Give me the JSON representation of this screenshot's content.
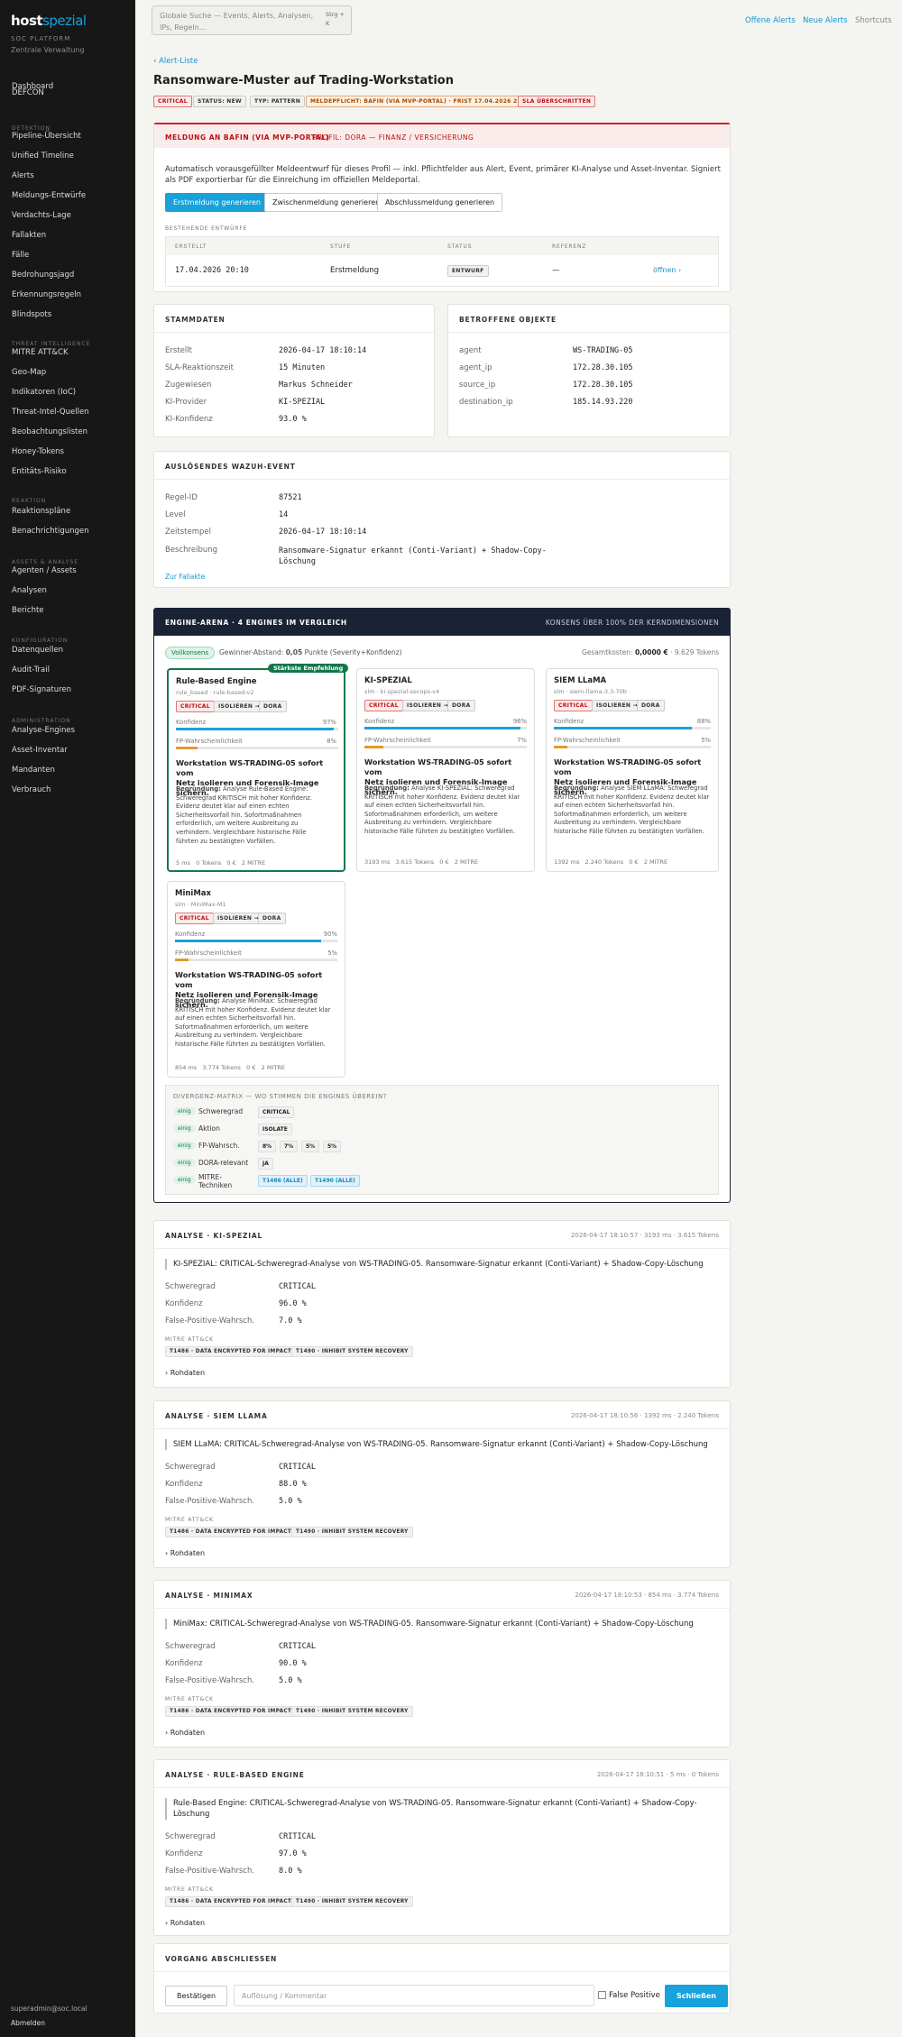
{
  "sidebar": {
    "logo_main": "host",
    "logo_accent": "spezial",
    "platform_label": "SOC PLATFORM",
    "platform_sub": "Zentrale Verwaltung",
    "groups": [
      {
        "title": "",
        "items": [
          "Dashboard",
          "DEFCON"
        ]
      },
      {
        "title": "DETEKTION",
        "items": [
          "Pipeline-Übersicht",
          "Unified Timeline",
          "Alerts",
          "Meldungs-Entwürfe",
          "Verdachts-Lage",
          "Fallakten",
          "Fälle",
          "Bedrohungsjagd",
          "Erkennungsregeln",
          "Blindspots"
        ]
      },
      {
        "title": "THREAT INTELLIGENCE",
        "items": [
          "MITRE ATT&CK",
          "Geo-Map",
          "Indikatoren (IoC)",
          "Threat-Intel-Quellen",
          "Beobachtungslisten",
          "Honey-Tokens",
          "Entitäts-Risiko"
        ]
      },
      {
        "title": "REAKTION",
        "items": [
          "Reaktionspläne",
          "Benachrichtigungen"
        ]
      },
      {
        "title": "ASSETS & ANALYSE",
        "items": [
          "Agenten / Assets",
          "Analysen",
          "Berichte"
        ]
      },
      {
        "title": "KONFIGURATION",
        "items": [
          "Datenquellen",
          "Audit-Trail",
          "PDF-Signaturen"
        ]
      },
      {
        "title": "ADMINISTRATION",
        "items": [
          "Analyse-Engines",
          "Asset-Inventar",
          "Mandanten",
          "Verbrauch"
        ]
      }
    ],
    "user": "superadmin@soc.local",
    "logout": "Abmelden"
  },
  "topbar": {
    "search_placeholder_l1": "Globale Suche — Events, Alerts, Analysen,",
    "search_placeholder_l2": "IPs, Regeln…",
    "shortcut": "Strg + K",
    "links": [
      "Offene Alerts",
      "Neue Alerts",
      "Shortcuts"
    ]
  },
  "page": {
    "back": "‹ Alert-Liste",
    "title": "Ransomware-Muster auf Trading-Workstation",
    "badges": [
      "CRITICAL",
      "STATUS: NEW",
      "TYP: PATTERN",
      "MELDEPFLICHT: BAFIN (VIA MVP-PORTAL) · FRIST 17.04.2026 22:10",
      "SLA ÜBERSCHRITTEN"
    ]
  },
  "bafin": {
    "title": "MELDUNG AN BAFIN (VIA MVP-PORTAL)",
    "profile": "PROFIL: DORA — FINANZ / VERSICHERUNG",
    "desc_l1": "Automatisch vorausgefüllter Meldeentwurf für dieses Profil — inkl. Pflichtfelder aus Alert, Event, primärer KI-Analyse und Asset-Inventar. Signiert",
    "desc_l2": "als PDF exportierbar für die Einreichung im offiziellen Meldeportal.",
    "buttons": [
      "Erstmeldung generieren",
      "Zwischenmeldung generieren",
      "Abschlussmeldung generieren"
    ],
    "drafts_title": "BESTEHENDE ENTWÜRFE",
    "columns": [
      "ERSTELLT",
      "STUFE",
      "STATUS",
      "REFERENZ"
    ],
    "row": {
      "created": "17.04.2026 20:10",
      "stage": "Erstmeldung",
      "status": "ENTWURF",
      "ref": "—",
      "action": "öffnen ›"
    }
  },
  "stamm": {
    "title": "STAMMDATEN",
    "rows": [
      {
        "k": "Erstellt",
        "v": "2026-04-17 18:10:14"
      },
      {
        "k": "SLA-Reaktionszeit",
        "v": "15 Minuten"
      },
      {
        "k": "Zugewiesen",
        "v": "Markus Schneider"
      },
      {
        "k": "KI-Provider",
        "v": "KI-SPEZIAL"
      },
      {
        "k": "KI-Konfidenz",
        "v": "93.0 %"
      }
    ]
  },
  "objects": {
    "title": "BETROFFENE OBJEKTE",
    "rows": [
      {
        "k": "agent",
        "v": "WS-TRADING-05"
      },
      {
        "k": "agent_ip",
        "v": "172.28.30.105"
      },
      {
        "k": "source_ip",
        "v": "172.28.30.105"
      },
      {
        "k": "destination_ip",
        "v": "185.14.93.220"
      }
    ]
  },
  "wazuh": {
    "title": "AUSLÖSENDES WAZUH-EVENT",
    "rows": [
      {
        "k": "Regel-ID",
        "v": "87521"
      },
      {
        "k": "Level",
        "v": "14"
      },
      {
        "k": "Zeitstempel",
        "v": "2026-04-17 18:10:14"
      }
    ],
    "desc_label": "Beschreibung",
    "desc_l1": "Ransomware-Signatur erkannt (Conti-Variant) + Shadow-Copy-",
    "desc_l2": "Löschung",
    "link": "Zur Fallakte"
  },
  "arena": {
    "title": "ENGINE-ARENA · 4 ENGINES IM VERGLEICH",
    "consensus": "KONSENS ÜBER 100% DER KERNDIMENSIONEN",
    "badge": "Vollkonsens",
    "gap_pre": "Gewinner-Abstand:",
    "gap_val": "0,05",
    "gap_post": "Punkte (Severity+Konfidenz)",
    "cost_pre": "Gesamtkosten:",
    "cost_val": "0,0000 €",
    "cost_post": "· 9.629 Tokens",
    "best_label": "Stärkste Empfehlung",
    "engines": [
      {
        "name": "Rule-Based Engine",
        "sub": "rule_based · rule-based-v2",
        "tags": [
          "CRITICAL",
          "ISOLIEREN →",
          "DORA"
        ],
        "conf_lbl": "Konfidenz",
        "conf": "97%",
        "conf_v": 0.97,
        "fp_lbl": "FP-Wahrscheinlichkeit",
        "fp": "8%",
        "fp_v": 0.08,
        "rec_l1": "Workstation WS-TRADING-05 sofort vom",
        "rec_l2": "Netz isolieren und Forensik-Image sichern.",
        "reason_lbl": "Begründung:",
        "reason": [
          "Analyse Rule-Based Engine:",
          "Schweregrad KRITISCH mit hoher Konfidenz.",
          "Evidenz deutet klar auf einen echten",
          "Sicherheitsvorfall hin. Sofortmaßnahmen",
          "erforderlich, um weitere Ausbreitung zu",
          "verhindern. Vergleichbare historische Fälle",
          "führten zu bestätigten Vorfällen."
        ],
        "foot": "5 ms   0 Tokens   0 €   2 MITRE"
      },
      {
        "name": "KI-SPEZIAL",
        "sub": "slm · ki-spezial-secops-v4",
        "tags": [
          "CRITICAL",
          "ISOLIEREN →",
          "DORA"
        ],
        "conf_lbl": "Konfidenz",
        "conf": "96%",
        "conf_v": 0.96,
        "fp_lbl": "FP-Wahrscheinlichkeit",
        "fp": "7%",
        "fp_v": 0.07,
        "rec_l1": "Workstation WS-TRADING-05 sofort vom",
        "rec_l2": "Netz isolieren und Forensik-Image sichern.",
        "reason_lbl": "Begründung:",
        "reason": [
          "Analyse KI-SPEZIAL: Schweregrad",
          "KRITISCH mit hoher Konfidenz. Evidenz deutet klar",
          "auf einen echten Sicherheitsvorfall hin.",
          "Sofortmaßnahmen erforderlich, um weitere",
          "Ausbreitung zu verhindern. Vergleichbare",
          "historische Fälle führten zu bestätigten Vorfällen."
        ],
        "foot": "3193 ms   3.615 Tokens   0 €   2 MITRE"
      },
      {
        "name": "SIEM LLaMA",
        "sub": "slm · siem-llama-3.3-70b",
        "tags": [
          "CRITICAL",
          "ISOLIEREN →",
          "DORA"
        ],
        "conf_lbl": "Konfidenz",
        "conf": "88%",
        "conf_v": 0.88,
        "fp_lbl": "FP-Wahrscheinlichkeit",
        "fp": "5%",
        "fp_v": 0.05,
        "rec_l1": "Workstation WS-TRADING-05 sofort vom",
        "rec_l2": "Netz isolieren und Forensik-Image sichern.",
        "reason_lbl": "Begründung:",
        "reason": [
          "Analyse SIEM LLaMA: Schweregrad",
          "KRITISCH mit hoher Konfidenz. Evidenz deutet klar",
          "auf einen echten Sicherheitsvorfall hin.",
          "Sofortmaßnahmen erforderlich, um weitere",
          "Ausbreitung zu verhindern. Vergleichbare",
          "historische Fälle führten zu bestätigten Vorfällen."
        ],
        "foot": "1392 ms   2.240 Tokens   0 €   2 MITRE"
      },
      {
        "name": "MiniMax",
        "sub": "slm · MiniMax-M1",
        "tags": [
          "CRITICAL",
          "ISOLIEREN →",
          "DORA"
        ],
        "conf_lbl": "Konfidenz",
        "conf": "90%",
        "conf_v": 0.9,
        "fp_lbl": "FP-Wahrscheinlichkeit",
        "fp": "5%",
        "fp_v": 0.05,
        "rec_l1": "Workstation WS-TRADING-05 sofort vom",
        "rec_l2": "Netz isolieren und Forensik-Image sichern.",
        "reason_lbl": "Begründung:",
        "reason": [
          "Analyse MiniMax: Schweregrad",
          "KRITISCH mit hoher Konfidenz. Evidenz deutet klar",
          "auf einen echten Sicherheitsvorfall hin.",
          "Sofortmaßnahmen erforderlich, um weitere",
          "Ausbreitung zu verhindern. Vergleichbare",
          "historische Fälle führten zu bestätigten Vorfällen."
        ],
        "foot": "854 ms   3.774 Tokens   0 €   2 MITRE"
      }
    ],
    "divergence_title": "DIVERGENZ-MATRIX — WO STIMMEN DIE ENGINES ÜBEREIN?",
    "divergence": [
      {
        "state": "einig",
        "label": "Schweregrad",
        "chips": [
          "CRITICAL"
        ]
      },
      {
        "state": "einig",
        "label": "Aktion",
        "chips": [
          "ISOLATE"
        ]
      },
      {
        "state": "einig",
        "label": "FP-Wahrsch.",
        "chips": [
          "8%",
          "7%",
          "5%",
          "5%"
        ]
      },
      {
        "state": "einig",
        "label": "DORA-relevant",
        "chips": [
          "JA"
        ]
      },
      {
        "state": "einig",
        "label": "MITRE-",
        "label2": "Techniken",
        "chips": [
          "T1486 (ALLE)",
          "T1490 (ALLE)"
        ]
      }
    ]
  },
  "analyses": [
    {
      "title": "ANALYSE · KI-SPEZIAL",
      "meta": "2026-04-17 18:10:57 · 3193 ms · 3.615 Tokens",
      "summary": [
        "KI-SPEZIAL: CRITICAL-Schweregrad-Analyse von WS-TRADING-05. Ransomware-Signatur erkannt (Conti-Variant) + Shadow-Copy-Löschung"
      ],
      "rows": [
        {
          "k": "Schweregrad",
          "v": "CRITICAL"
        },
        {
          "k": "Konfidenz",
          "v": "96.0 %"
        },
        {
          "k": "False-Positive-Wahrsch.",
          "v": "7.0 %"
        }
      ],
      "mitre_lbl": "MITRE ATT&CK",
      "mitre": [
        "T1486 · DATA ENCRYPTED FOR IMPACT",
        "T1490 · INHIBIT SYSTEM RECOVERY"
      ],
      "raw": "› Rohdaten"
    },
    {
      "title": "ANALYSE · SIEM LLAMA",
      "meta": "2026-04-17 18:10:56 · 1392 ms · 2.240 Tokens",
      "summary": [
        "SIEM LLaMA: CRITICAL-Schweregrad-Analyse von WS-TRADING-05. Ransomware-Signatur erkannt (Conti-Variant) + Shadow-Copy-Löschung"
      ],
      "rows": [
        {
          "k": "Schweregrad",
          "v": "CRITICAL"
        },
        {
          "k": "Konfidenz",
          "v": "88.0 %"
        },
        {
          "k": "False-Positive-Wahrsch.",
          "v": "5.0 %"
        }
      ],
      "mitre_lbl": "MITRE ATT&CK",
      "mitre": [
        "T1486 · DATA ENCRYPTED FOR IMPACT",
        "T1490 · INHIBIT SYSTEM RECOVERY"
      ],
      "raw": "› Rohdaten"
    },
    {
      "title": "ANALYSE · MINIMAX",
      "meta": "2026-04-17 18:10:53 · 854 ms · 3.774 Tokens",
      "summary": [
        "MiniMax: CRITICAL-Schweregrad-Analyse von WS-TRADING-05. Ransomware-Signatur erkannt (Conti-Variant) + Shadow-Copy-Löschung"
      ],
      "rows": [
        {
          "k": "Schweregrad",
          "v": "CRITICAL"
        },
        {
          "k": "Konfidenz",
          "v": "90.0 %"
        },
        {
          "k": "False-Positive-Wahrsch.",
          "v": "5.0 %"
        }
      ],
      "mitre_lbl": "MITRE ATT&CK",
      "mitre": [
        "T1486 · DATA ENCRYPTED FOR IMPACT",
        "T1490 · INHIBIT SYSTEM RECOVERY"
      ],
      "raw": "› Rohdaten"
    },
    {
      "title": "ANALYSE · RULE-BASED ENGINE",
      "meta": "2026-04-17 18:10:51 · 5 ms · 0 Tokens",
      "summary": [
        "Rule-Based Engine: CRITICAL-Schweregrad-Analyse von WS-TRADING-05. Ransomware-Signatur erkannt (Conti-Variant) + Shadow-Copy-",
        "Löschung"
      ],
      "rows": [
        {
          "k": "Schweregrad",
          "v": "CRITICAL"
        },
        {
          "k": "Konfidenz",
          "v": "97.0 %"
        },
        {
          "k": "False-Positive-Wahrsch.",
          "v": "8.0 %"
        }
      ],
      "mitre_lbl": "MITRE ATT&CK",
      "mitre": [
        "T1486 · DATA ENCRYPTED FOR IMPACT",
        "T1490 · INHIBIT SYSTEM RECOVERY"
      ],
      "raw": "› Rohdaten"
    }
  ],
  "close": {
    "title": "VORGANG ABSCHLIESSEN",
    "confirm": "Bestätigen",
    "placeholder": "Auflösung / Kommentar",
    "fp_label": "False Positive",
    "submit": "Schließen"
  },
  "colors": {
    "accent": "#17a2dc",
    "sidebar": "#171717",
    "critical": "#b11111",
    "arena_header": "#1a2335",
    "best": "#12784a"
  }
}
